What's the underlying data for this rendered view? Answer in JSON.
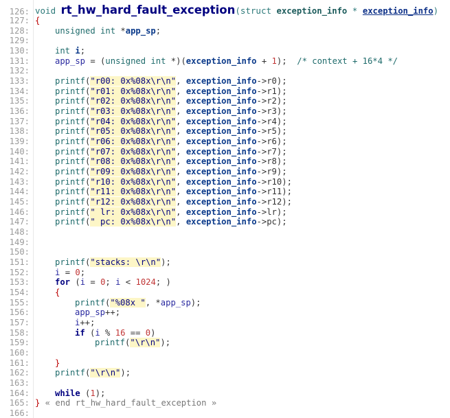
{
  "editor": {
    "lines": [
      {
        "no": "126:",
        "parts": [
          [
            "kwtitle",
            "void "
          ],
          [
            "fn",
            "rt_hw_hard_fault_exception"
          ],
          [
            "kwtitle",
            "("
          ],
          [
            "kwtitle",
            "struct "
          ],
          [
            "param",
            "exception_info"
          ],
          [
            "kwtitle",
            " * "
          ],
          [
            "paramu",
            "exception_info"
          ],
          [
            "kwtitle",
            ")"
          ]
        ]
      },
      {
        "no": "127:",
        "parts": [
          [
            "brace",
            "{"
          ]
        ]
      },
      {
        "no": "128:",
        "indent": 1,
        "parts": [
          [
            "kw",
            "unsigned int "
          ],
          [
            "op",
            "*"
          ],
          [
            "idb",
            "app_sp"
          ],
          [
            "op",
            ";"
          ]
        ]
      },
      {
        "no": "129:",
        "parts": []
      },
      {
        "no": "130:",
        "indent": 1,
        "parts": [
          [
            "kw",
            "int "
          ],
          [
            "idb",
            "i"
          ],
          [
            "op",
            ";"
          ]
        ]
      },
      {
        "no": "131:",
        "indent": 1,
        "parts": [
          [
            "id",
            "app_sp "
          ],
          [
            "op",
            "= ("
          ],
          [
            "kw",
            "unsigned int "
          ],
          [
            "op",
            "*)("
          ],
          [
            "idb",
            "exception_info"
          ],
          [
            "op",
            " + "
          ],
          [
            "num",
            "1"
          ],
          [
            "op",
            ");  "
          ],
          [
            "cm",
            "/* context + 16*4 */"
          ]
        ]
      },
      {
        "no": "132:",
        "parts": []
      },
      {
        "no": "133:",
        "indent": 1,
        "parts": [
          [
            "kw",
            "printf"
          ],
          [
            "op",
            "("
          ],
          [
            "str",
            "\"r00: 0x%08x\\r\\n\""
          ],
          [
            "op",
            ", "
          ],
          [
            "idb",
            "exception_info"
          ],
          [
            "op",
            "->r0);"
          ]
        ]
      },
      {
        "no": "134:",
        "indent": 1,
        "parts": [
          [
            "kw",
            "printf"
          ],
          [
            "op",
            "("
          ],
          [
            "str",
            "\"r01: 0x%08x\\r\\n\""
          ],
          [
            "op",
            ", "
          ],
          [
            "idb",
            "exception_info"
          ],
          [
            "op",
            "->r1);"
          ]
        ]
      },
      {
        "no": "135:",
        "indent": 1,
        "parts": [
          [
            "kw",
            "printf"
          ],
          [
            "op",
            "("
          ],
          [
            "str",
            "\"r02: 0x%08x\\r\\n\""
          ],
          [
            "op",
            ", "
          ],
          [
            "idb",
            "exception_info"
          ],
          [
            "op",
            "->r2);"
          ]
        ]
      },
      {
        "no": "136:",
        "indent": 1,
        "parts": [
          [
            "kw",
            "printf"
          ],
          [
            "op",
            "("
          ],
          [
            "str",
            "\"r03: 0x%08x\\r\\n\""
          ],
          [
            "op",
            ", "
          ],
          [
            "idb",
            "exception_info"
          ],
          [
            "op",
            "->r3);"
          ]
        ]
      },
      {
        "no": "137:",
        "indent": 1,
        "parts": [
          [
            "kw",
            "printf"
          ],
          [
            "op",
            "("
          ],
          [
            "str",
            "\"r04: 0x%08x\\r\\n\""
          ],
          [
            "op",
            ", "
          ],
          [
            "idb",
            "exception_info"
          ],
          [
            "op",
            "->r4);"
          ]
        ]
      },
      {
        "no": "138:",
        "indent": 1,
        "parts": [
          [
            "kw",
            "printf"
          ],
          [
            "op",
            "("
          ],
          [
            "str",
            "\"r05: 0x%08x\\r\\n\""
          ],
          [
            "op",
            ", "
          ],
          [
            "idb",
            "exception_info"
          ],
          [
            "op",
            "->r5);"
          ]
        ]
      },
      {
        "no": "139:",
        "indent": 1,
        "parts": [
          [
            "kw",
            "printf"
          ],
          [
            "op",
            "("
          ],
          [
            "str",
            "\"r06: 0x%08x\\r\\n\""
          ],
          [
            "op",
            ", "
          ],
          [
            "idb",
            "exception_info"
          ],
          [
            "op",
            "->r6);"
          ]
        ]
      },
      {
        "no": "140:",
        "indent": 1,
        "parts": [
          [
            "kw",
            "printf"
          ],
          [
            "op",
            "("
          ],
          [
            "str",
            "\"r07: 0x%08x\\r\\n\""
          ],
          [
            "op",
            ", "
          ],
          [
            "idb",
            "exception_info"
          ],
          [
            "op",
            "->r7);"
          ]
        ]
      },
      {
        "no": "141:",
        "indent": 1,
        "parts": [
          [
            "kw",
            "printf"
          ],
          [
            "op",
            "("
          ],
          [
            "str",
            "\"r08: 0x%08x\\r\\n\""
          ],
          [
            "op",
            ", "
          ],
          [
            "idb",
            "exception_info"
          ],
          [
            "op",
            "->r8);"
          ]
        ]
      },
      {
        "no": "142:",
        "indent": 1,
        "parts": [
          [
            "kw",
            "printf"
          ],
          [
            "op",
            "("
          ],
          [
            "str",
            "\"r09: 0x%08x\\r\\n\""
          ],
          [
            "op",
            ", "
          ],
          [
            "idb",
            "exception_info"
          ],
          [
            "op",
            "->r9);"
          ]
        ]
      },
      {
        "no": "143:",
        "indent": 1,
        "parts": [
          [
            "kw",
            "printf"
          ],
          [
            "op",
            "("
          ],
          [
            "str",
            "\"r10: 0x%08x\\r\\n\""
          ],
          [
            "op",
            ", "
          ],
          [
            "idb",
            "exception_info"
          ],
          [
            "op",
            "->r10);"
          ]
        ]
      },
      {
        "no": "144:",
        "indent": 1,
        "parts": [
          [
            "kw",
            "printf"
          ],
          [
            "op",
            "("
          ],
          [
            "str",
            "\"r11: 0x%08x\\r\\n\""
          ],
          [
            "op",
            ", "
          ],
          [
            "idb",
            "exception_info"
          ],
          [
            "op",
            "->r11);"
          ]
        ]
      },
      {
        "no": "145:",
        "indent": 1,
        "parts": [
          [
            "kw",
            "printf"
          ],
          [
            "op",
            "("
          ],
          [
            "str",
            "\"r12: 0x%08x\\r\\n\""
          ],
          [
            "op",
            ", "
          ],
          [
            "idb",
            "exception_info"
          ],
          [
            "op",
            "->r12);"
          ]
        ]
      },
      {
        "no": "146:",
        "indent": 1,
        "parts": [
          [
            "kw",
            "printf"
          ],
          [
            "op",
            "("
          ],
          [
            "str",
            "\" lr: 0x%08x\\r\\n\""
          ],
          [
            "op",
            ", "
          ],
          [
            "idb",
            "exception_info"
          ],
          [
            "op",
            "->lr);"
          ]
        ]
      },
      {
        "no": "147:",
        "indent": 1,
        "parts": [
          [
            "kw",
            "printf"
          ],
          [
            "op",
            "("
          ],
          [
            "str",
            "\" pc: 0x%08x\\r\\n\""
          ],
          [
            "op",
            ", "
          ],
          [
            "idb",
            "exception_info"
          ],
          [
            "op",
            "->pc);"
          ]
        ]
      },
      {
        "no": "148:",
        "parts": []
      },
      {
        "no": "149:",
        "parts": []
      },
      {
        "no": "150:",
        "parts": []
      },
      {
        "no": "151:",
        "indent": 1,
        "parts": [
          [
            "kw",
            "printf"
          ],
          [
            "op",
            "("
          ],
          [
            "str",
            "\"stacks: \\r\\n\""
          ],
          [
            "op",
            ");"
          ]
        ]
      },
      {
        "no": "152:",
        "indent": 1,
        "parts": [
          [
            "id",
            "i "
          ],
          [
            "op",
            "= "
          ],
          [
            "num",
            "0"
          ],
          [
            "op",
            ";"
          ]
        ]
      },
      {
        "no": "153:",
        "indent": 1,
        "parts": [
          [
            "bkw",
            "for "
          ],
          [
            "op",
            "("
          ],
          [
            "id",
            "i "
          ],
          [
            "op",
            "= "
          ],
          [
            "num",
            "0"
          ],
          [
            "op",
            "; "
          ],
          [
            "id",
            "i "
          ],
          [
            "op",
            "< "
          ],
          [
            "num",
            "1024"
          ],
          [
            "op",
            "; )"
          ]
        ]
      },
      {
        "no": "154:",
        "indent": 1,
        "parts": [
          [
            "brace",
            "{"
          ]
        ]
      },
      {
        "no": "155:",
        "indent": 2,
        "parts": [
          [
            "kw",
            "printf"
          ],
          [
            "op",
            "("
          ],
          [
            "str",
            "\"%08x \""
          ],
          [
            "op",
            ", *"
          ],
          [
            "id",
            "app_sp"
          ],
          [
            "op",
            ");"
          ]
        ]
      },
      {
        "no": "156:",
        "indent": 2,
        "parts": [
          [
            "id",
            "app_sp"
          ],
          [
            "op",
            "++;"
          ]
        ]
      },
      {
        "no": "157:",
        "indent": 2,
        "parts": [
          [
            "id",
            "i"
          ],
          [
            "op",
            "++;"
          ]
        ]
      },
      {
        "no": "158:",
        "indent": 2,
        "parts": [
          [
            "bkw",
            "if "
          ],
          [
            "op",
            "("
          ],
          [
            "id",
            "i "
          ],
          [
            "op",
            "% "
          ],
          [
            "num",
            "16"
          ],
          [
            "op",
            " == "
          ],
          [
            "num",
            "0"
          ],
          [
            "op",
            ")"
          ]
        ]
      },
      {
        "no": "159:",
        "indent": 3,
        "parts": [
          [
            "kw",
            "printf"
          ],
          [
            "op",
            "("
          ],
          [
            "str",
            "\"\\r\\n\""
          ],
          [
            "op",
            ");"
          ]
        ]
      },
      {
        "no": "160:",
        "parts": []
      },
      {
        "no": "161:",
        "indent": 1,
        "parts": [
          [
            "brace",
            "}"
          ]
        ]
      },
      {
        "no": "162:",
        "indent": 1,
        "parts": [
          [
            "kw",
            "printf"
          ],
          [
            "op",
            "("
          ],
          [
            "str",
            "\"\\r\\n\""
          ],
          [
            "op",
            ");"
          ]
        ]
      },
      {
        "no": "163:",
        "parts": []
      },
      {
        "no": "164:",
        "indent": 1,
        "parts": [
          [
            "bkw",
            "while "
          ],
          [
            "op",
            "("
          ],
          [
            "num",
            "1"
          ],
          [
            "op",
            ");"
          ]
        ]
      },
      {
        "no": "165:",
        "parts": [
          [
            "brace",
            "}"
          ],
          [
            "fold",
            " « end rt_hw_hard_fault_exception »"
          ]
        ]
      },
      {
        "no": "166:",
        "parts": []
      }
    ]
  }
}
